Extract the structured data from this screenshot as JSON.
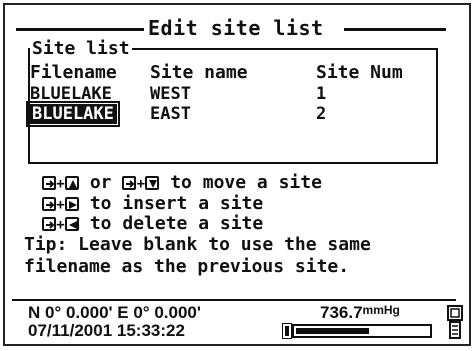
{
  "screen": {
    "title": "Edit site list",
    "site_list_label": "Site list",
    "columns": [
      "Filename",
      "Site name",
      "Site Num"
    ],
    "rows": [
      {
        "filename": "BLUELAKE",
        "site_name": "WEST",
        "site_num": "1"
      },
      {
        "filename": "BLUELAKE",
        "site_name": "EAST",
        "site_num": "2"
      }
    ],
    "help": {
      "move_or": "or",
      "move_text": "to move a site",
      "insert_text": "to insert a site",
      "delete_text": "to delete a site"
    },
    "tip_line1": "Tip: Leave blank to use the same",
    "tip_line2": "filename as the previous site."
  },
  "status": {
    "gps": "N 0° 0.000' E  0° 0.000'",
    "datetime": "07/11/2001 15:33:22",
    "pressure": "736.7",
    "pressure_unit": "mmHg",
    "battery_level": 0.55
  },
  "icons": [
    "enter-key-icon",
    "up-arrow-icon",
    "down-arrow-icon",
    "right-arrow-icon",
    "left-arrow-icon",
    "battery-icon",
    "device-icon"
  ]
}
